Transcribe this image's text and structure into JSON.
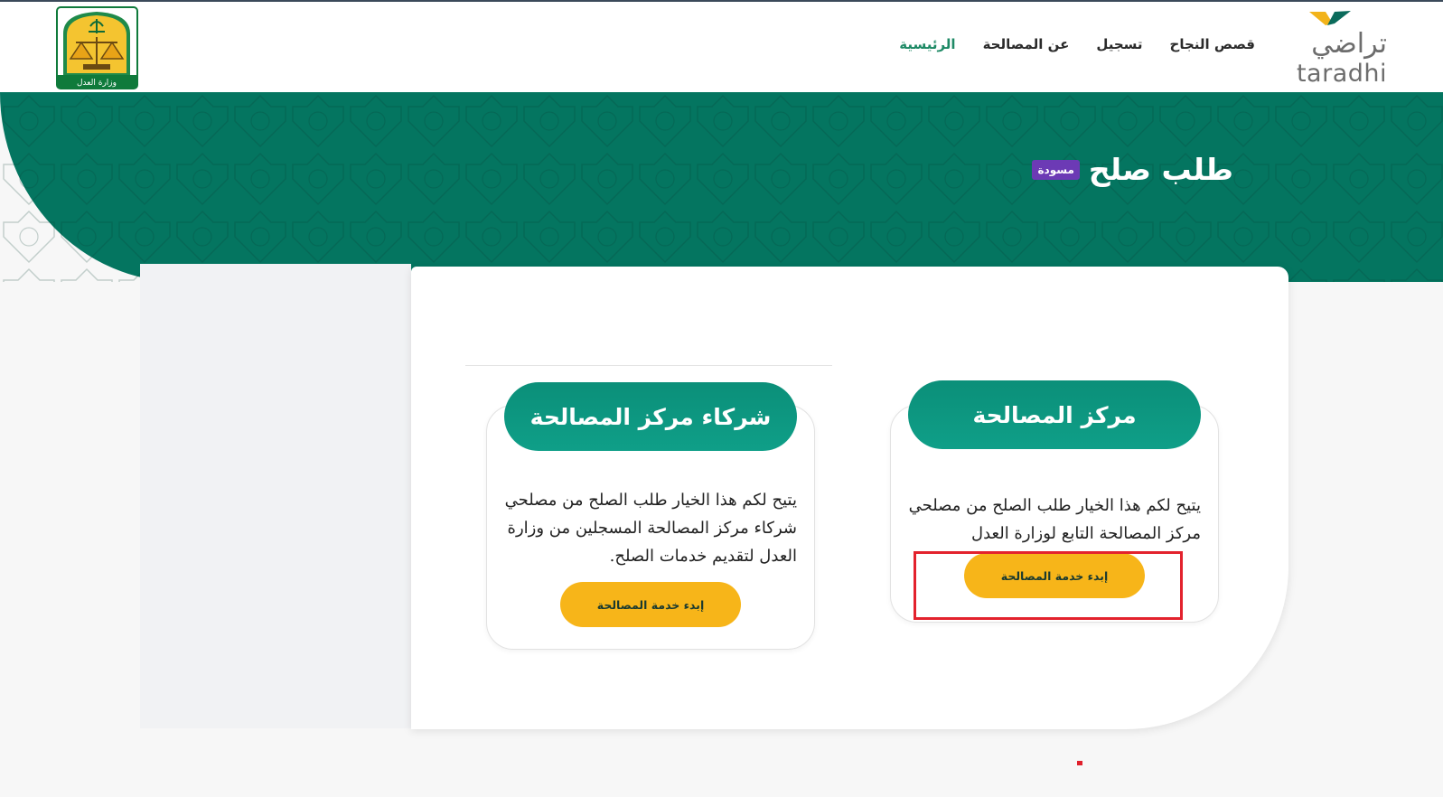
{
  "header": {
    "brand_ar": "تراضي",
    "brand_en": "taradhi",
    "nav": [
      {
        "label": "الرئيسية",
        "active": true
      },
      {
        "label": "عن المصالحة",
        "active": false
      },
      {
        "label": "تسجيل",
        "active": false
      },
      {
        "label": "قصص النجاح",
        "active": false
      }
    ],
    "ministry_logo_text": "وزارة العدل"
  },
  "banner": {
    "title": "طلب صلح",
    "badge": "مسودة"
  },
  "options": [
    {
      "title": "مركز المصالحة",
      "description": "يتيح لكم هذا الخيار طلب الصلح من مصلحي مركز المصالحة التابع لوزارة العدل",
      "button": "إبدء خدمة المصالحة"
    },
    {
      "title": "شركاء مركز المصالحة",
      "description": "يتيح لكم هذا الخيار طلب الصلح من مصلحي شركاء مركز المصالحة المسجلين من وزارة العدل لتقديم خدمات الصلح.",
      "button": "إبدء خدمة المصالحة"
    }
  ],
  "colors": {
    "primary_green": "#047560",
    "accent_yellow": "#f7b519",
    "badge_purple": "#6c3ab5",
    "highlight_red": "#e3222d"
  }
}
